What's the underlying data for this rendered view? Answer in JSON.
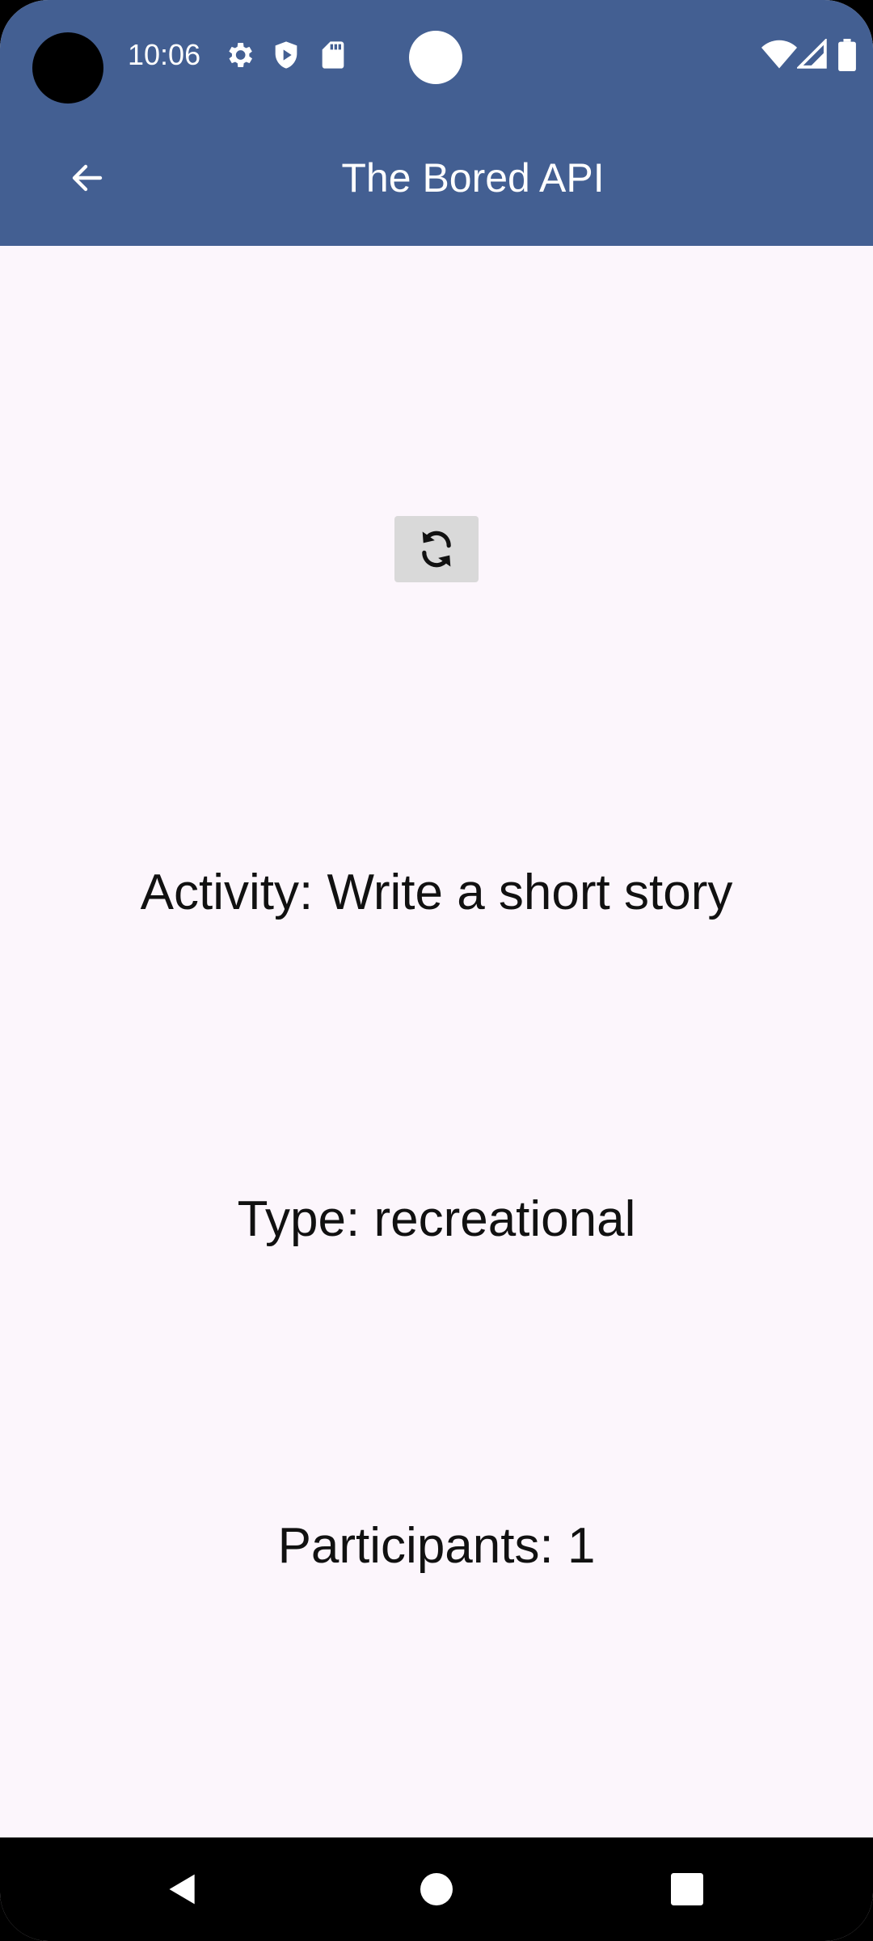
{
  "status_bar": {
    "time": "10:06",
    "icons": [
      "gear-icon",
      "shield-play-icon",
      "sd-card-icon",
      "wifi-icon",
      "signal-icon",
      "battery-icon"
    ]
  },
  "app_bar": {
    "title": "The Bored API",
    "back_icon": "arrow-back-icon"
  },
  "main": {
    "refresh_icon": "refresh-icon",
    "activity": "Activity: Write a short story",
    "type": "Type: recreational",
    "participants": "Participants: 1"
  },
  "nav_bar": {
    "buttons": [
      "back-triangle-icon",
      "home-circle-icon",
      "recents-square-icon"
    ]
  },
  "colors": {
    "app_bar": "#435f92",
    "background": "#fcf6fc",
    "refresh_button": "#d9d9d9"
  }
}
